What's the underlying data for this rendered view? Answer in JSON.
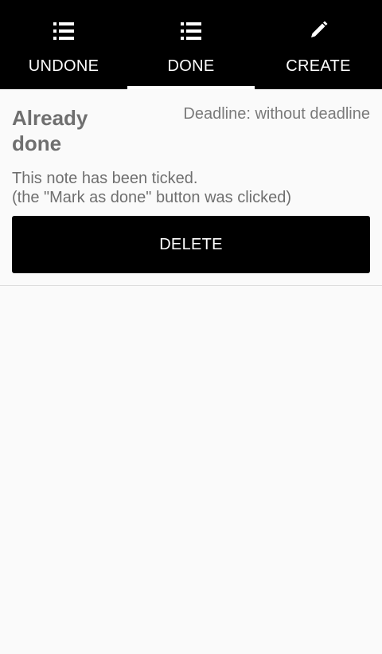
{
  "tabs": [
    {
      "label": "UNDONE",
      "icon": "list-icon",
      "selected": false
    },
    {
      "label": "DONE",
      "icon": "list-icon",
      "selected": true
    },
    {
      "label": "CREATE",
      "icon": "pencil-icon",
      "selected": false
    }
  ],
  "note": {
    "title": "Already done",
    "deadline": "Deadline: without deadline",
    "body_line1": "This note has been ticked.",
    "body_line2": "(the \"Mark as done\" button was clicked)",
    "delete_label": "DELETE"
  },
  "colors": {
    "tabbar_bg": "#000000",
    "background": "#fafafa",
    "button_bg": "#000000",
    "text_gray": "#6f6f6f"
  }
}
